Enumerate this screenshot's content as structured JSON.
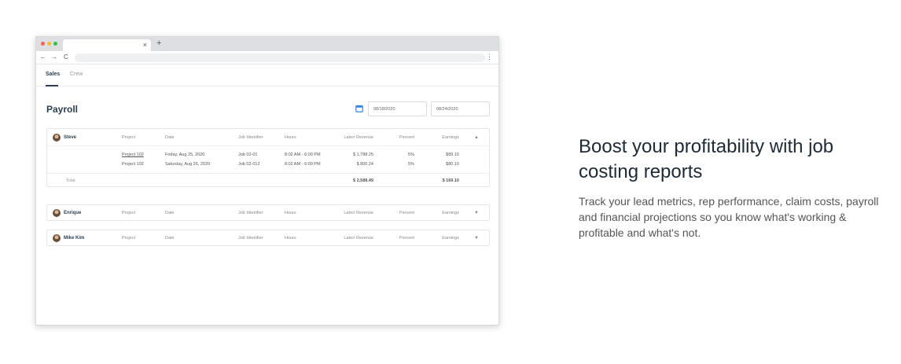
{
  "browser": {
    "tab_close": "×",
    "new_tab": "+",
    "kebab": "⋮",
    "back": "←",
    "forward": "→",
    "reload": "C"
  },
  "app_tabs": {
    "sales": "Sales",
    "crew": "Crew"
  },
  "page": {
    "title": "Payroll",
    "date_from": "08/18/2020",
    "date_to": "08/24/2020"
  },
  "columns": {
    "project": "Project",
    "date": "Date",
    "job": "Job Identifier",
    "hours": "Hours",
    "revenue": "Labor Revenue",
    "percent": "Percent",
    "earnings": "Earnings"
  },
  "employees": [
    {
      "name": "Steve",
      "expanded": true,
      "rows": [
        {
          "project": "Project 102",
          "date": "Friday, Aug 25, 2020",
          "job": "Job 02-01",
          "hours": "8:02 AM - 6:00 PM",
          "revenue": "$ 1,788.25",
          "percent": "5%",
          "earnings": "$89.10"
        },
        {
          "project": "Project 102",
          "date": "Saturday, Aug 26, 2020",
          "job": "Job 02-012",
          "hours": "8:02 AM - 6:00 PM",
          "revenue": "$ 800.24",
          "percent": "5%",
          "earnings": "$80.10"
        }
      ],
      "total": {
        "label": "Total",
        "revenue": "$ 2,588.49",
        "earnings": "$ 169.10"
      }
    },
    {
      "name": "Enrique",
      "expanded": false
    },
    {
      "name": "Mike Kim",
      "expanded": false
    }
  ],
  "icons": {
    "collapse": "▲",
    "expand": "▼",
    "calendar": "calendar-icon"
  },
  "colors": {
    "accent": "#3a86e0",
    "title": "#2c3e50"
  },
  "marketing": {
    "headline": "Boost your profitability with job costing reports",
    "body": "Track your lead metrics, rep performance, claim costs, payroll and financial projections so you know what's working & profitable and what's not."
  }
}
